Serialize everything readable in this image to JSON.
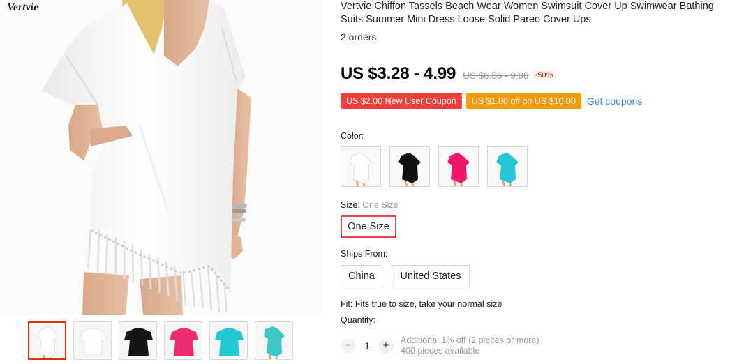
{
  "gallery": {
    "brand": "Vertvie",
    "main_image": "white-tassel-cover-up-photo",
    "thumbnails": [
      {
        "name": "thumb-white-model",
        "color": "#f4f4f4",
        "active": true
      },
      {
        "name": "thumb-white-flat",
        "color": "#f4f4f4",
        "active": false
      },
      {
        "name": "thumb-black",
        "color": "#151515",
        "active": false
      },
      {
        "name": "thumb-rose",
        "color": "#ef2d73",
        "active": false
      },
      {
        "name": "thumb-cyan",
        "color": "#22c7d4",
        "active": false
      },
      {
        "name": "thumb-cyan-model",
        "color": "#3cc6c8",
        "active": false
      }
    ]
  },
  "product": {
    "title": "Vertvie Chiffon Tassels Beach Wear Women Swimsuit Cover Up Swimwear Bathing Suits Summer Mini Dress Loose Solid Pareo Cover Ups",
    "orders": "2 orders",
    "price": "US $3.28 - 4.99",
    "original_price": "US $6.56 - 9.98",
    "discount": "-50%"
  },
  "coupons": {
    "new_user": "US $2.00 New User Coupon",
    "store": "US $1.00 off on US $10.00",
    "get_link": "Get coupons"
  },
  "color": {
    "label": "Color:",
    "options": [
      {
        "name": "White",
        "hex": "#ffffff"
      },
      {
        "name": "Black",
        "hex": "#111111"
      },
      {
        "name": "Rose",
        "hex": "#f0176a"
      },
      {
        "name": "Sky Blue",
        "hex": "#23c5d6"
      }
    ]
  },
  "size": {
    "label": "Size:",
    "selected_text": "One Size",
    "options": [
      "One Size"
    ]
  },
  "ships_from": {
    "label": "Ships From:",
    "options": [
      "China",
      "United States"
    ]
  },
  "fit": "Fit: Fits true to size, take your normal size",
  "quantity": {
    "label": "Quantity:",
    "minus": "−",
    "plus": "+",
    "value": "1",
    "discount_note": "Additional 1% off (2 pieces or more)",
    "available": "400 pieces available"
  },
  "colors": {
    "accent": "#e62e04",
    "coupon_red": "#f0403c",
    "coupon_orange": "#f69a07",
    "link": "#3a8fd0"
  }
}
